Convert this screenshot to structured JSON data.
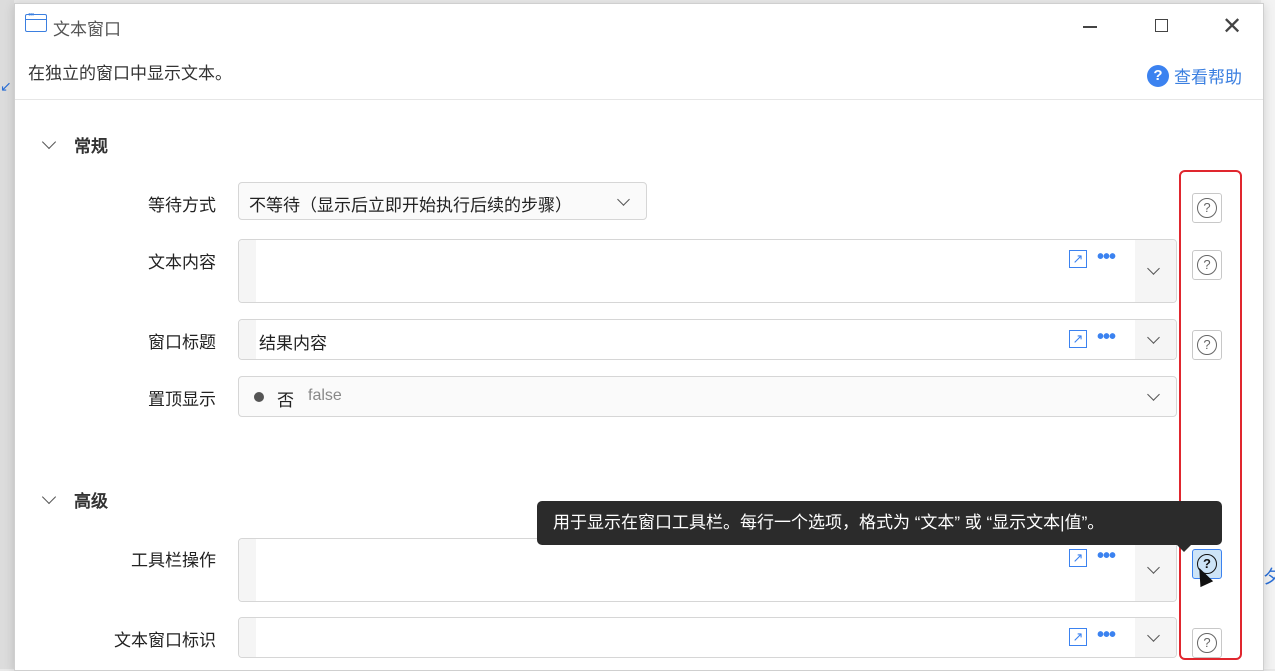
{
  "window": {
    "title": "文本窗口",
    "description": "在独立的窗口中显示文本。",
    "help_link": "查看帮助"
  },
  "sections": {
    "general": "常规",
    "advanced": "高级"
  },
  "fields": {
    "wait_mode": {
      "label": "等待方式",
      "value": "不等待（显示后立即开始执行后续的步骤）"
    },
    "text_content": {
      "label": "文本内容",
      "value": ""
    },
    "window_title": {
      "label": "窗口标题",
      "value": "结果内容"
    },
    "pin_top": {
      "label": "置顶显示",
      "value": "否",
      "raw": "false"
    },
    "toolbar_actions": {
      "label": "工具栏操作",
      "value": ""
    },
    "window_id": {
      "label": "文本窗口标识",
      "value": ""
    }
  },
  "tooltip": "用于显示在窗口工具栏。每行一个选项，格式为 “文本” 或 “显示文本|值”。",
  "icons": {
    "help": "question-circle-icon",
    "expand": "expand-arrow-icon",
    "more": "more-dots-icon"
  },
  "colors": {
    "accent": "#3b82f0",
    "highlight": "#e0262e",
    "tooltip_bg": "#2b2b2b"
  }
}
